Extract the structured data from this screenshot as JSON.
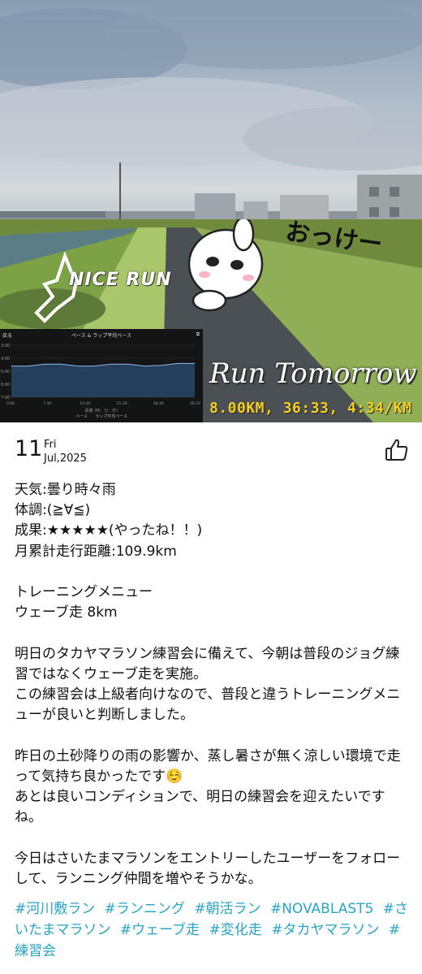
{
  "photo": {
    "nice_run": "NICE RUN",
    "okke": "おっけー",
    "run_tomorrow": "Run Tomorrow",
    "stats": "8.00KM, 36:33, 4:34/KM",
    "chart": {
      "back": "戻る",
      "title": "ペース & ラップ平均ペース",
      "y_ticks": [
        "3:00",
        "4:00",
        "5:00",
        "6:00",
        "7:00"
      ],
      "x_ticks": [
        "0:00",
        "7:30",
        "14:30",
        "21:30",
        "28:30",
        "36:33"
      ],
      "subtitle": "距離 (時：分：秒)",
      "legend_pace": "ペース",
      "legend_lap": "ラップ平均ペース",
      "pace_series": [
        4.6,
        4.6,
        4.45,
        4.45,
        4.6,
        4.6,
        4.45,
        4.45,
        4.6,
        4.55,
        4.4,
        4.4
      ]
    }
  },
  "post": {
    "day": "11",
    "dow": "Fri",
    "month_year": "Jul,2025",
    "lines": [
      "天気:曇り時々雨",
      "体調:(≧∀≦)",
      "成果:★★★★★(やったね！！)",
      "月累計走行距離:109.9km",
      "",
      "トレーニングメニュー",
      "ウェーブ走 8km",
      "",
      "明日のタカヤマラソン練習会に備えて、今朝は普段のジョグ練習ではなくウェーブ走を実施。",
      "この練習会は上級者向けなので、普段と違うトレーニングメニューが良いと判断しました。",
      "",
      "昨日の土砂降りの雨の影響か、蒸し暑さが無く涼しい環境で走って気持ち良かったです☺️",
      "あとは良いコンディションで、明日の練習会を迎えたいですね。",
      "",
      "今日はさいたまマラソンをエントリーしたユーザーをフォローして、ランニング仲間を増やそうかな。"
    ],
    "tags": [
      "#河川敷ラン",
      "#ランニング",
      "#朝活ラン",
      "#NOVABLAST5",
      "#さいたまマラソン",
      "#ウェーブ走",
      "#変化走",
      "#タカヤマラソン",
      "#練習会"
    ]
  },
  "colors": {
    "hashtag": "#27a5c9",
    "stats": "#f5d020"
  },
  "icons": {
    "like": "thumbs-up-icon"
  }
}
